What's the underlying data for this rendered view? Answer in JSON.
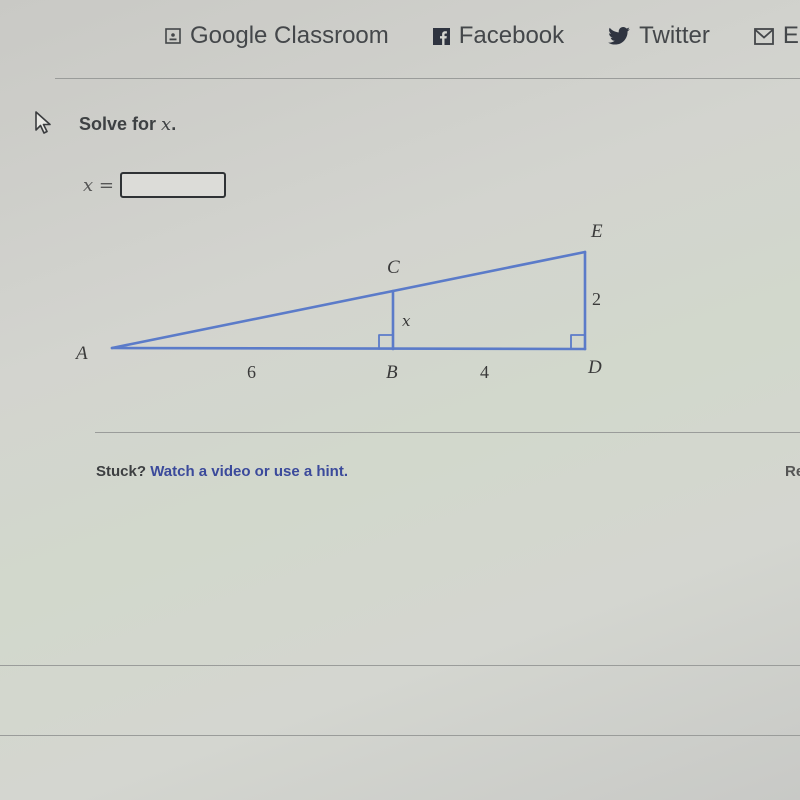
{
  "share_bar": {
    "items": [
      {
        "label": "Google Classroom",
        "icon": "google-classroom-icon"
      },
      {
        "label": "Facebook",
        "icon": "facebook-icon"
      },
      {
        "label": "Twitter",
        "icon": "twitter-icon"
      },
      {
        "label": "Em",
        "icon": "email-icon"
      }
    ]
  },
  "problem": {
    "prompt_text": "Solve for ",
    "prompt_var": "x",
    "prompt_end": ".",
    "answer_var": "x",
    "answer_eq": " =",
    "answer_value": "",
    "answer_placeholder": ""
  },
  "figure": {
    "line_color": "#5b7bc9",
    "vertices": {
      "A": "A",
      "B": "B",
      "C": "C",
      "D": "D",
      "E": "E"
    },
    "segment_labels": {
      "AB": "6",
      "BD": "4",
      "DE": "2",
      "BC": "x"
    },
    "right_angles": [
      "B",
      "D"
    ]
  },
  "help": {
    "stuck_label": "Stuck?",
    "link_text": "Watch a video or use a hint."
  },
  "report": {
    "label": "Re"
  }
}
